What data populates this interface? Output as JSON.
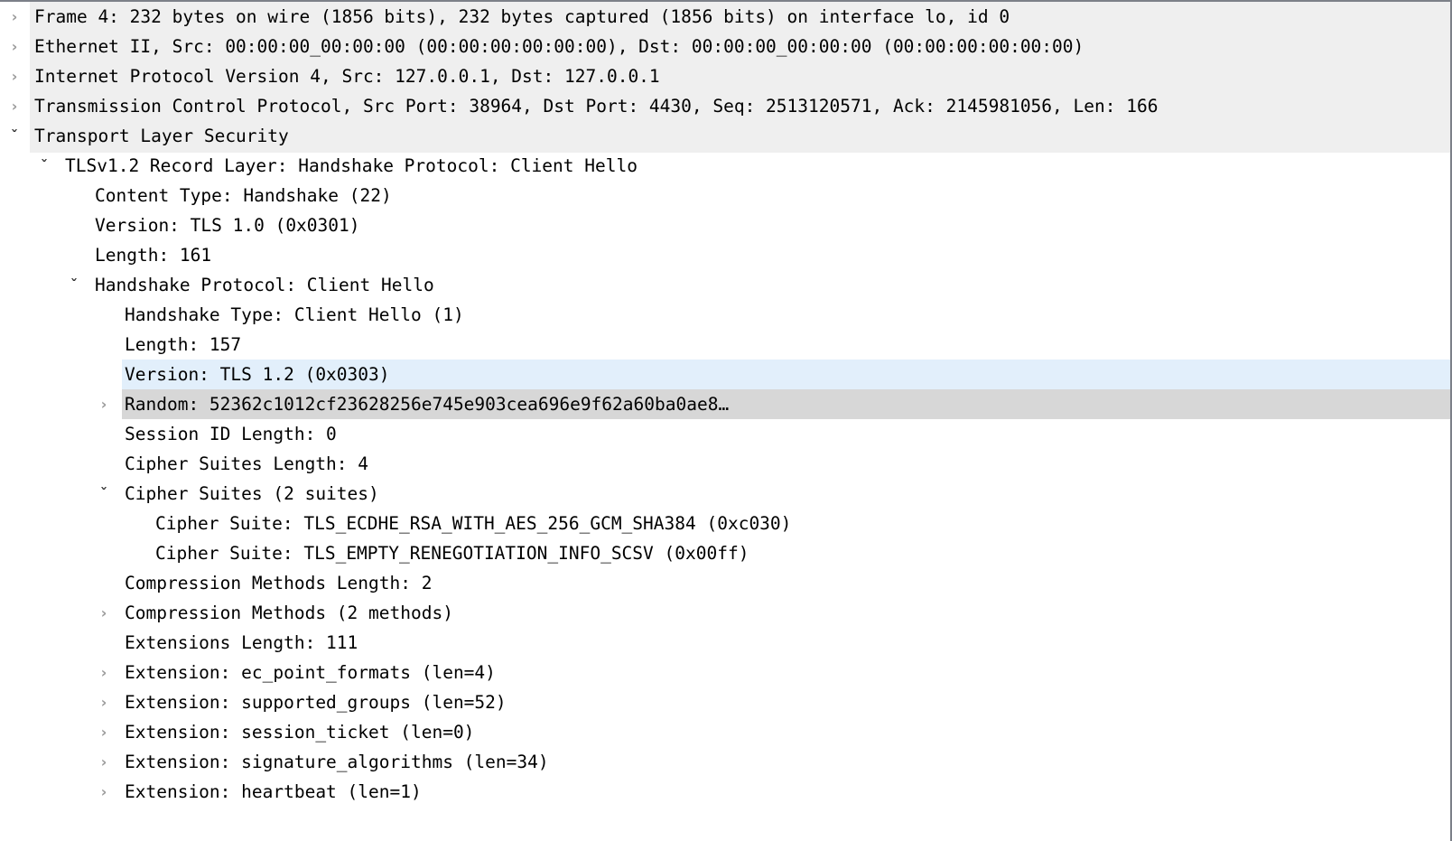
{
  "pane": {
    "name": "Packet Details",
    "colors": {
      "protocol_band": "#efefef",
      "selected_row": "#e2effb",
      "focused_row": "#d7d7d7",
      "text": "#000000",
      "collapsed_chevron": "#9a9a9a",
      "expanded_chevron": "#333333",
      "border": "#7c8088"
    },
    "icons": {
      "collapsed": "›",
      "expanded": "ˇ"
    }
  },
  "rows": [
    {
      "id": "frame",
      "level": 0,
      "toggle": "collapsed",
      "text": "Frame 4: 232 bytes on wire (1856 bits), 232 bytes captured (1856 bits) on interface lo, id 0",
      "highlight": "none"
    },
    {
      "id": "ethernet",
      "level": 0,
      "toggle": "collapsed",
      "text": "Ethernet II, Src: 00:00:00_00:00:00 (00:00:00:00:00:00), Dst: 00:00:00_00:00:00 (00:00:00:00:00:00)",
      "highlight": "none"
    },
    {
      "id": "ipv4",
      "level": 0,
      "toggle": "collapsed",
      "text": "Internet Protocol Version 4, Src: 127.0.0.1, Dst: 127.0.0.1",
      "highlight": "none"
    },
    {
      "id": "tcp",
      "level": 0,
      "toggle": "collapsed",
      "text": "Transmission Control Protocol, Src Port: 38964, Dst Port: 4430, Seq: 2513120571, Ack: 2145981056, Len: 166",
      "highlight": "none"
    },
    {
      "id": "tls",
      "level": 0,
      "toggle": "expanded",
      "text": "Transport Layer Security",
      "highlight": "none"
    },
    {
      "id": "record-layer",
      "level": 1,
      "toggle": "expanded",
      "text": "TLSv1.2 Record Layer: Handshake Protocol: Client Hello",
      "highlight": "none"
    },
    {
      "id": "content-type",
      "level": 2,
      "toggle": "none",
      "text": "Content Type: Handshake (22)",
      "highlight": "none"
    },
    {
      "id": "record-version",
      "level": 2,
      "toggle": "none",
      "text": "Version: TLS 1.0 (0x0301)",
      "highlight": "none"
    },
    {
      "id": "record-length",
      "level": 2,
      "toggle": "none",
      "text": "Length: 161",
      "highlight": "none"
    },
    {
      "id": "handshake-protocol",
      "level": 2,
      "toggle": "expanded",
      "text": "Handshake Protocol: Client Hello",
      "highlight": "none"
    },
    {
      "id": "handshake-type",
      "level": 3,
      "toggle": "none",
      "text": "Handshake Type: Client Hello (1)",
      "highlight": "none"
    },
    {
      "id": "handshake-length",
      "level": 3,
      "toggle": "none",
      "text": "Length: 157",
      "highlight": "none"
    },
    {
      "id": "handshake-version",
      "level": 3,
      "toggle": "none",
      "text": "Version: TLS 1.2 (0x0303)",
      "highlight": "blue"
    },
    {
      "id": "random",
      "level": 3,
      "toggle": "collapsed",
      "text": "Random: 52362c1012cf23628256e745e903cea696e9f62a60ba0ae8…",
      "highlight": "gray"
    },
    {
      "id": "session-id-length",
      "level": 3,
      "toggle": "none",
      "text": "Session ID Length: 0",
      "highlight": "none"
    },
    {
      "id": "cipher-suites-length",
      "level": 3,
      "toggle": "none",
      "text": "Cipher Suites Length: 4",
      "highlight": "none"
    },
    {
      "id": "cipher-suites",
      "level": 3,
      "toggle": "expanded",
      "text": "Cipher Suites (2 suites)",
      "highlight": "none"
    },
    {
      "id": "cipher-suite-1",
      "level": 4,
      "toggle": "none",
      "text": "Cipher Suite: TLS_ECDHE_RSA_WITH_AES_256_GCM_SHA384 (0xc030)",
      "highlight": "none"
    },
    {
      "id": "cipher-suite-2",
      "level": 4,
      "toggle": "none",
      "text": "Cipher Suite: TLS_EMPTY_RENEGOTIATION_INFO_SCSV (0x00ff)",
      "highlight": "none"
    },
    {
      "id": "compression-methods-length",
      "level": 3,
      "toggle": "none",
      "text": "Compression Methods Length: 2",
      "highlight": "none"
    },
    {
      "id": "compression-methods",
      "level": 3,
      "toggle": "collapsed",
      "text": "Compression Methods (2 methods)",
      "highlight": "none"
    },
    {
      "id": "extensions-length",
      "level": 3,
      "toggle": "none",
      "text": "Extensions Length: 111",
      "highlight": "none"
    },
    {
      "id": "extension-ec-point-formats",
      "level": 3,
      "toggle": "collapsed",
      "text": "Extension: ec_point_formats (len=4)",
      "highlight": "none"
    },
    {
      "id": "extension-supported-groups",
      "level": 3,
      "toggle": "collapsed",
      "text": "Extension: supported_groups (len=52)",
      "highlight": "none"
    },
    {
      "id": "extension-session-ticket",
      "level": 3,
      "toggle": "collapsed",
      "text": "Extension: session_ticket (len=0)",
      "highlight": "none"
    },
    {
      "id": "extension-signature-algorithms",
      "level": 3,
      "toggle": "collapsed",
      "text": "Extension: signature_algorithms (len=34)",
      "highlight": "none"
    },
    {
      "id": "extension-heartbeat",
      "level": 3,
      "toggle": "collapsed",
      "text": "Extension: heartbeat (len=1)",
      "highlight": "none"
    }
  ]
}
